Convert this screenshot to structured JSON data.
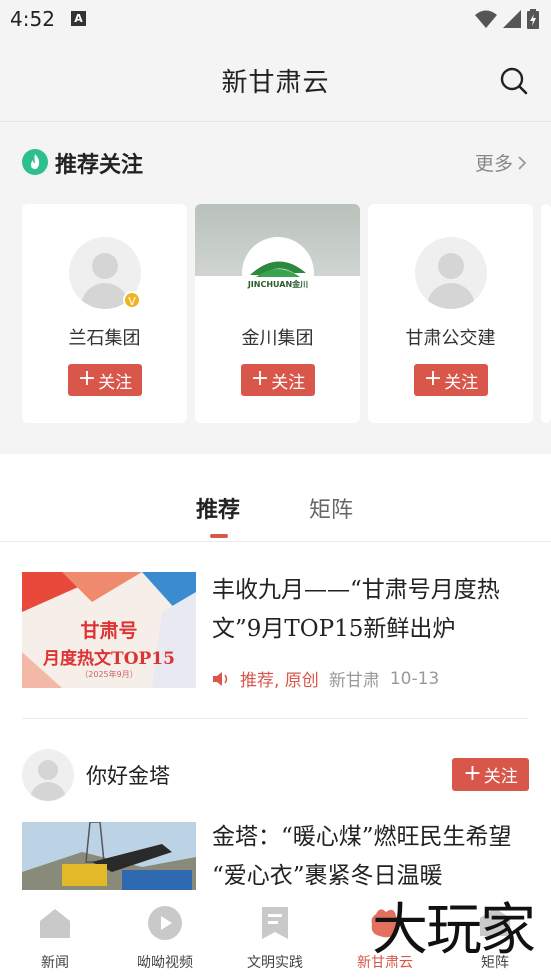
{
  "status": {
    "time": "4:52",
    "notification_icon": "a-icon"
  },
  "header": {
    "title": "新甘肃云",
    "search_icon": "search-icon"
  },
  "recommend": {
    "title": "推荐关注",
    "more_label": "更多",
    "cards": [
      {
        "name": "兰石集团",
        "follow_label": "关注",
        "verified": true
      },
      {
        "name": "金川集团",
        "follow_label": "关注",
        "logo_text": "JINCHUAN",
        "logo_sub": "金川"
      },
      {
        "name": "甘肃公交建",
        "follow_label": "关注"
      }
    ]
  },
  "tabs": [
    {
      "label": "推荐",
      "active": true
    },
    {
      "label": "矩阵",
      "active": false
    }
  ],
  "articles": [
    {
      "title": "丰收九月——“甘肃号月度热文”9月TOP15新鲜出炉",
      "thumb_line1": "甘肃号",
      "thumb_line2": "月度热文TOP15",
      "thumb_line3": "（2025年9月）",
      "tags": "推荐, 原创",
      "source": "新甘肃",
      "date": "10-13"
    }
  ],
  "author_post": {
    "author": "你好金塔",
    "follow_label": "关注",
    "title": "金塔：“暖心煤”燃旺民生希望 “爱心衣”裹紧冬日温暖"
  },
  "bottom_nav": [
    {
      "label": "新闻",
      "icon": "home-icon"
    },
    {
      "label": "呦呦视频",
      "icon": "video-icon"
    },
    {
      "label": "文明实践",
      "icon": "bookmark-icon"
    },
    {
      "label": "新甘肃云",
      "icon": "cloud-icon",
      "active": true
    },
    {
      "label": "矩阵",
      "icon": "matrix-icon"
    }
  ],
  "watermark": "大玩家",
  "colors": {
    "accent": "#d9574a",
    "green": "#2cc08c",
    "background": "#f4f4f4"
  }
}
